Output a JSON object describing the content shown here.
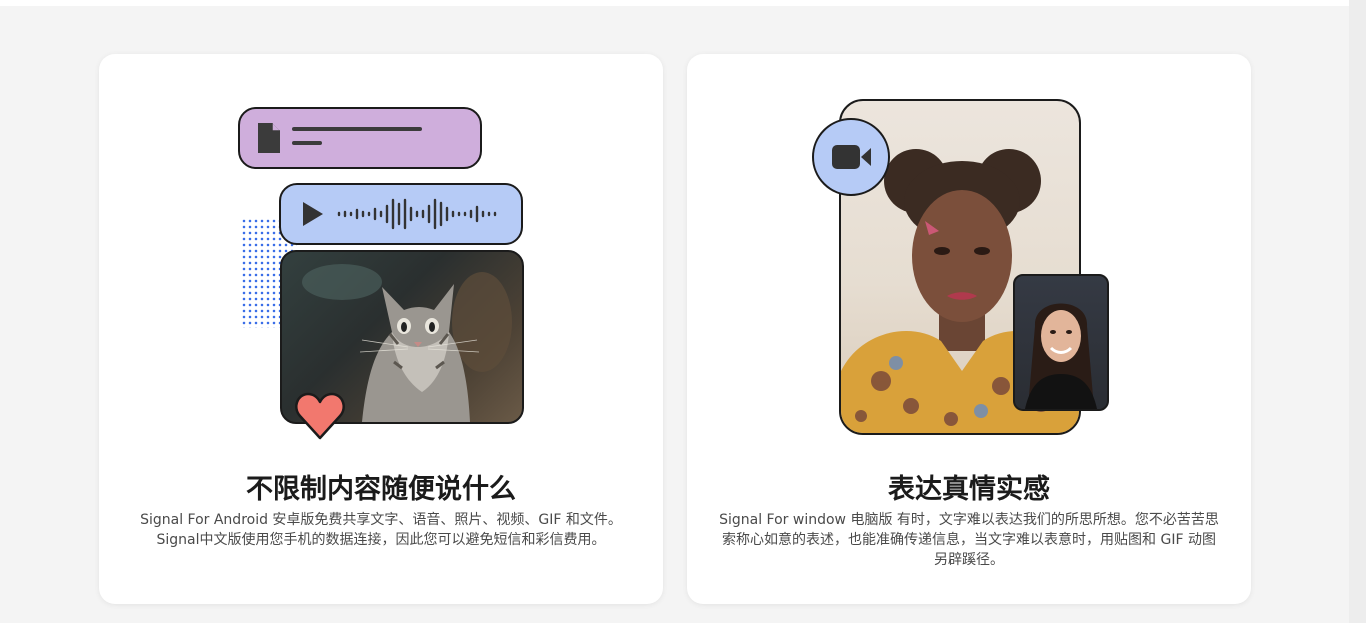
{
  "cards": [
    {
      "title": "不限制内容随便说什么",
      "description": "Signal For Android 安卓版免费共享文字、语音、照片、视频、GIF 和文件。Signal中文版使用您手机的数据连接，因此您可以避免短信和彩信费用。"
    },
    {
      "title": "表达真情实感",
      "description": "Signal For window 电脑版 有时，文字难以表达我们的所思所想。您不必苦苦思索称心如意的表述，也能准确传递信息，当文字难以表意时，用贴图和 GIF 动图另辟蹊径。"
    }
  ],
  "colors": {
    "purple_bubble": "#cfaedc",
    "blue_bubble": "#b6cbf6",
    "heart": "#f2786e",
    "dots": "#3a6ee8"
  },
  "icons": [
    "file-icon",
    "play-icon",
    "video-camera-icon",
    "heart-icon"
  ]
}
